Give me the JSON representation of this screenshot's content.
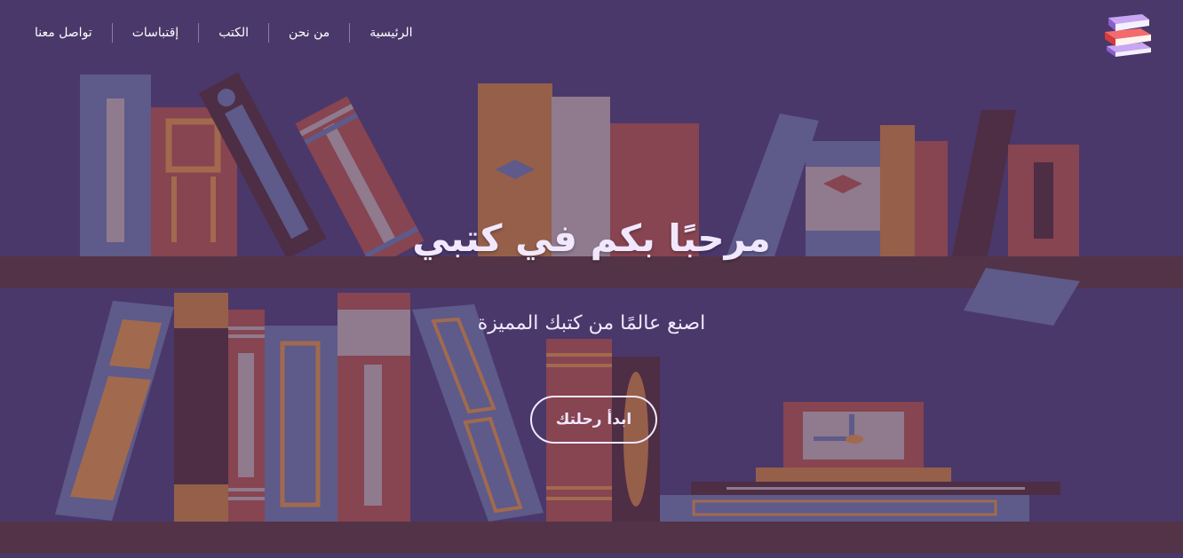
{
  "nav": {
    "items": [
      {
        "label": "الرئيسية"
      },
      {
        "label": "من نحن"
      },
      {
        "label": "الكتب"
      },
      {
        "label": "إقتباسات"
      },
      {
        "label": "تواصل معنا"
      }
    ]
  },
  "logo": {
    "icon": "books-stack-icon"
  },
  "hero": {
    "title": "مرحبًا بكم في كتبي",
    "subtitle": "اصنع عالمًا من كتبك المميزة",
    "cta_label": "ابدأ رحلتك"
  },
  "colors": {
    "background": "#4a386a",
    "shelf": "#533347",
    "text": "#f1e8ff"
  }
}
